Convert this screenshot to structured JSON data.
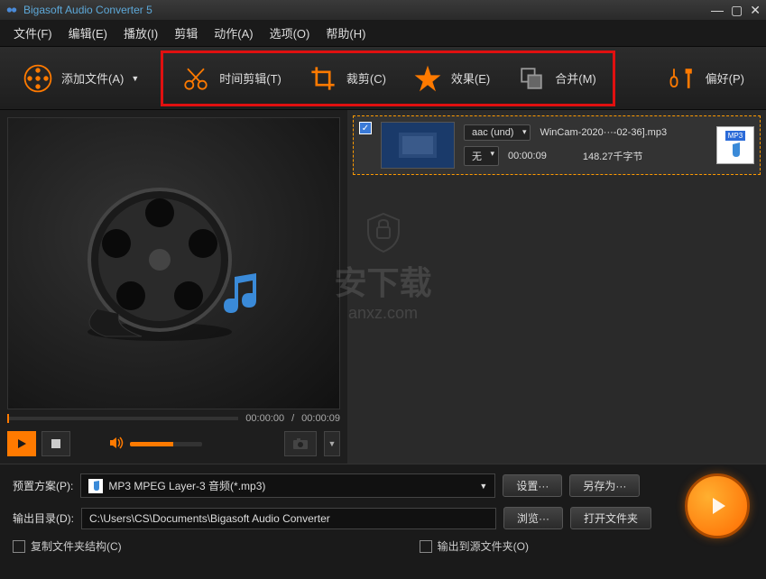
{
  "titlebar": {
    "title": "Bigasoft Audio Converter 5"
  },
  "menu": {
    "file": "文件(F)",
    "edit": "编辑(E)",
    "play": "播放(I)",
    "trim": "剪辑",
    "action": "动作(A)",
    "options": "选项(O)",
    "help": "帮助(H)"
  },
  "toolbar": {
    "add": "添加文件(A)",
    "trim": "时间剪辑(T)",
    "crop": "裁剪(C)",
    "effect": "效果(E)",
    "merge": "合并(M)",
    "pref": "偏好(P)"
  },
  "preview": {
    "time_current": "00:00:00",
    "time_total": "00:00:09"
  },
  "file": {
    "codec": "aac (und)",
    "name": "WinCam-2020···-02-36].mp3",
    "none": "无",
    "duration": "00:00:09",
    "size": "148.27千字节",
    "badge": "MP3"
  },
  "bottom": {
    "preset_label": "预置方案(P):",
    "preset_value": "MP3 MPEG Layer-3 音频(*.mp3)",
    "settings": "设置···",
    "saveas": "另存为···",
    "output_label": "输出目录(D):",
    "output_value": "C:\\Users\\CS\\Documents\\Bigasoft Audio Converter",
    "browse": "浏览···",
    "open_folder": "打开文件夹",
    "copy_struct": "复制文件夹结构(C)",
    "output_src": "输出到源文件夹(O)"
  },
  "watermark": {
    "text": "安下载",
    "url": "anxz.com"
  }
}
